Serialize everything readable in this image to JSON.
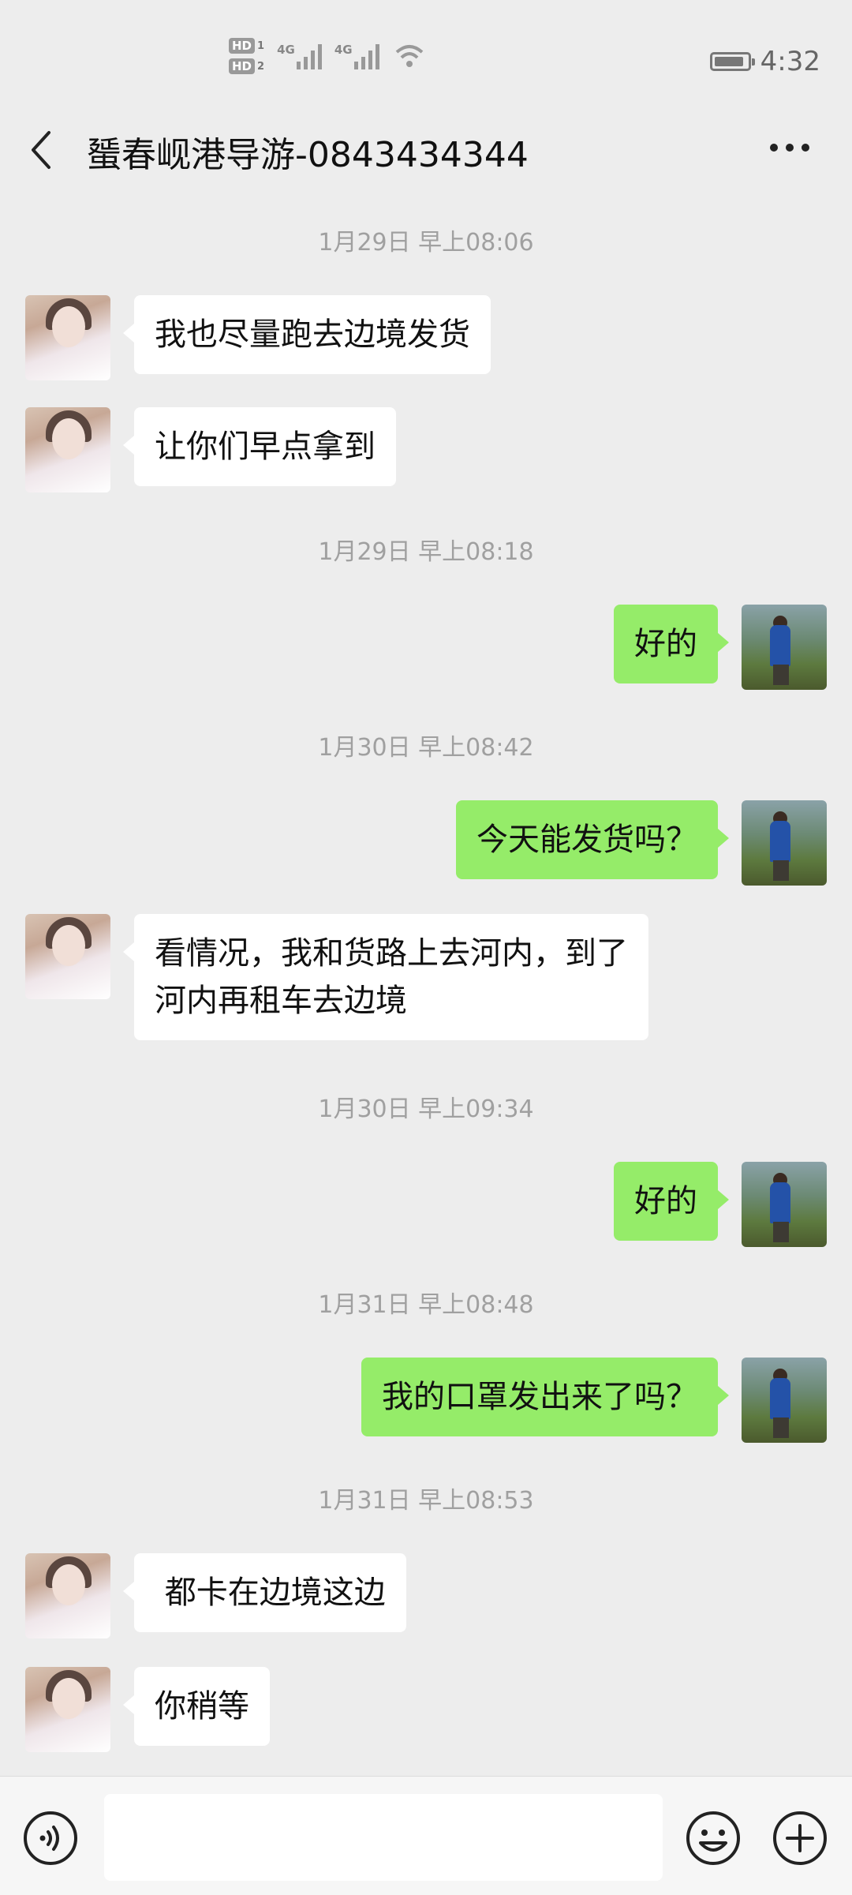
{
  "status_bar": {
    "sim1_label": "HD",
    "sim1_num": "1",
    "sim2_label": "HD",
    "sim2_num": "2",
    "net1": "4G",
    "net2": "4G",
    "time": "4:32",
    "battery_level": 0.9
  },
  "header": {
    "title": "蜑春岘港导游-0843434344",
    "back_icon": "chevron-left-icon",
    "more_icon": "more-dots-icon"
  },
  "messages": [
    {
      "type": "timestamp",
      "text": "1月29日 早上08:06"
    },
    {
      "type": "in",
      "text": "我也尽量跑去边境发货"
    },
    {
      "type": "in",
      "text": "让你们早点拿到"
    },
    {
      "type": "timestamp",
      "text": "1月29日 早上08:18"
    },
    {
      "type": "out",
      "text": "好的"
    },
    {
      "type": "timestamp",
      "text": "1月30日 早上08:42"
    },
    {
      "type": "out",
      "text": "今天能发货吗？"
    },
    {
      "type": "in",
      "lines": [
        "看情况，我和货路上去河内，到了",
        "河内再租车去边境"
      ]
    },
    {
      "type": "timestamp",
      "text": "1月30日 早上09:34"
    },
    {
      "type": "out",
      "text": "好的"
    },
    {
      "type": "timestamp",
      "text": "1月31日 早上08:48"
    },
    {
      "type": "out",
      "text": "我的口罩发出来了吗？"
    },
    {
      "type": "timestamp",
      "text": "1月31日 早上08:53"
    },
    {
      "type": "in",
      "text": " 都卡在边境这边"
    },
    {
      "type": "in",
      "text": "你稍等"
    }
  ],
  "input_bar": {
    "placeholder": "",
    "voice_icon": "voice-icon",
    "emoji_icon": "emoji-icon",
    "plus_icon": "plus-icon"
  },
  "colors": {
    "background": "#ededed",
    "bubble_in": "#ffffff",
    "bubble_out": "#95ec69"
  }
}
